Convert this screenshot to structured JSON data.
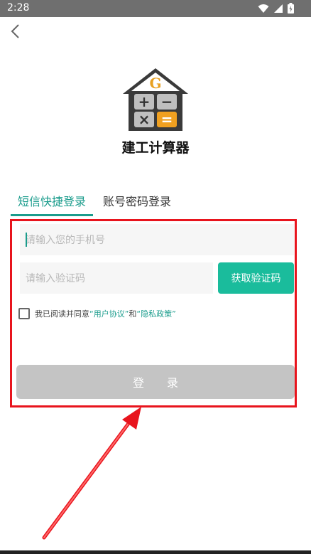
{
  "status_bar": {
    "time": "2:28"
  },
  "app": {
    "name": "建工计算器",
    "logo_letter": "G",
    "logo_symbols": [
      "+",
      "−",
      "×",
      "="
    ]
  },
  "tabs": [
    {
      "label": "短信快捷登录",
      "active": true
    },
    {
      "label": "账号密码登录",
      "active": false
    }
  ],
  "form": {
    "phone_placeholder": "请输入您的手机号",
    "code_placeholder": "请输入验证码",
    "get_code_label": "获取验证码",
    "agree_prefix": "我已阅读并同意",
    "user_agreement": "“用户协议”",
    "and_text": "和",
    "privacy_policy": "“隐私政策”",
    "login_label": "登录"
  },
  "colors": {
    "accent": "#1a9c8c",
    "button_green": "#1abc9c",
    "disabled": "#c4c4c4",
    "annotation_red": "#e8141d"
  }
}
